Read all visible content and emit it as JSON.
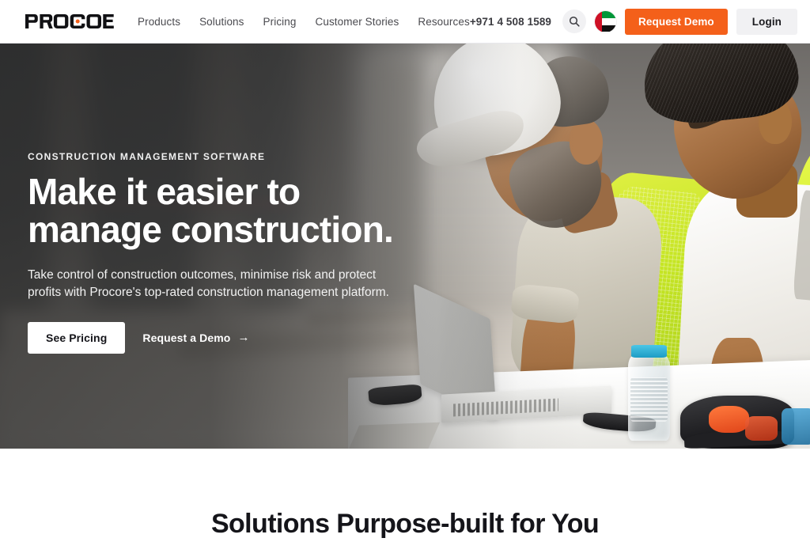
{
  "header": {
    "logo_text": "PROCORE",
    "logo_accent_color": "#F4601A",
    "nav": [
      {
        "label": "Products"
      },
      {
        "label": "Solutions"
      },
      {
        "label": "Pricing"
      },
      {
        "label": "Customer Stories"
      },
      {
        "label": "Resources"
      }
    ],
    "phone": "+971 4 508 1589",
    "search_icon": "search-icon",
    "locale_flag": "uae-flag-icon",
    "demo_button": "Request Demo",
    "login_button": "Login"
  },
  "hero": {
    "eyebrow": "CONSTRUCTION MANAGEMENT SOFTWARE",
    "headline_line1": "Make it easier to",
    "headline_line2": "manage construction.",
    "subhead": "Take control of construction outcomes, minimise risk and protect profits with Procore's top-rated construction management platform.",
    "primary_cta": "See Pricing",
    "secondary_cta": "Request a Demo",
    "secondary_cta_arrow": "→",
    "image_alt": "Two construction workers in high-visibility vests and a hard hat reviewing plans on a laptop at a white table on a jobsite"
  },
  "section": {
    "title": "Solutions Purpose-built for You"
  },
  "colors": {
    "brand_orange": "#F4601A",
    "text_dark": "#15151a",
    "nav_grey": "#4a4a4f",
    "button_grey": "#f1f1f3"
  }
}
